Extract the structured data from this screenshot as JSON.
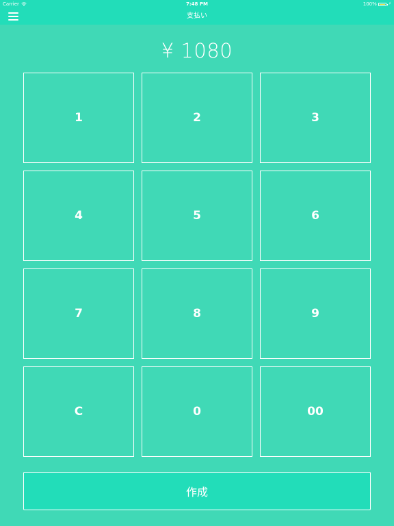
{
  "status_bar": {
    "carrier": "Carrier",
    "time": "7:48 PM",
    "battery": "100%"
  },
  "nav": {
    "title": "支払い",
    "menu_icon": "hamburger-menu-icon"
  },
  "amount": "¥ 1080",
  "keypad": {
    "keys": [
      "1",
      "2",
      "3",
      "4",
      "5",
      "6",
      "7",
      "8",
      "9",
      "C",
      "0",
      "00"
    ]
  },
  "create_label": "作成",
  "colors": {
    "background": "#40d9b6",
    "accent": "#22ddb9",
    "text": "#ffffff",
    "battery": "#f2e14a"
  }
}
